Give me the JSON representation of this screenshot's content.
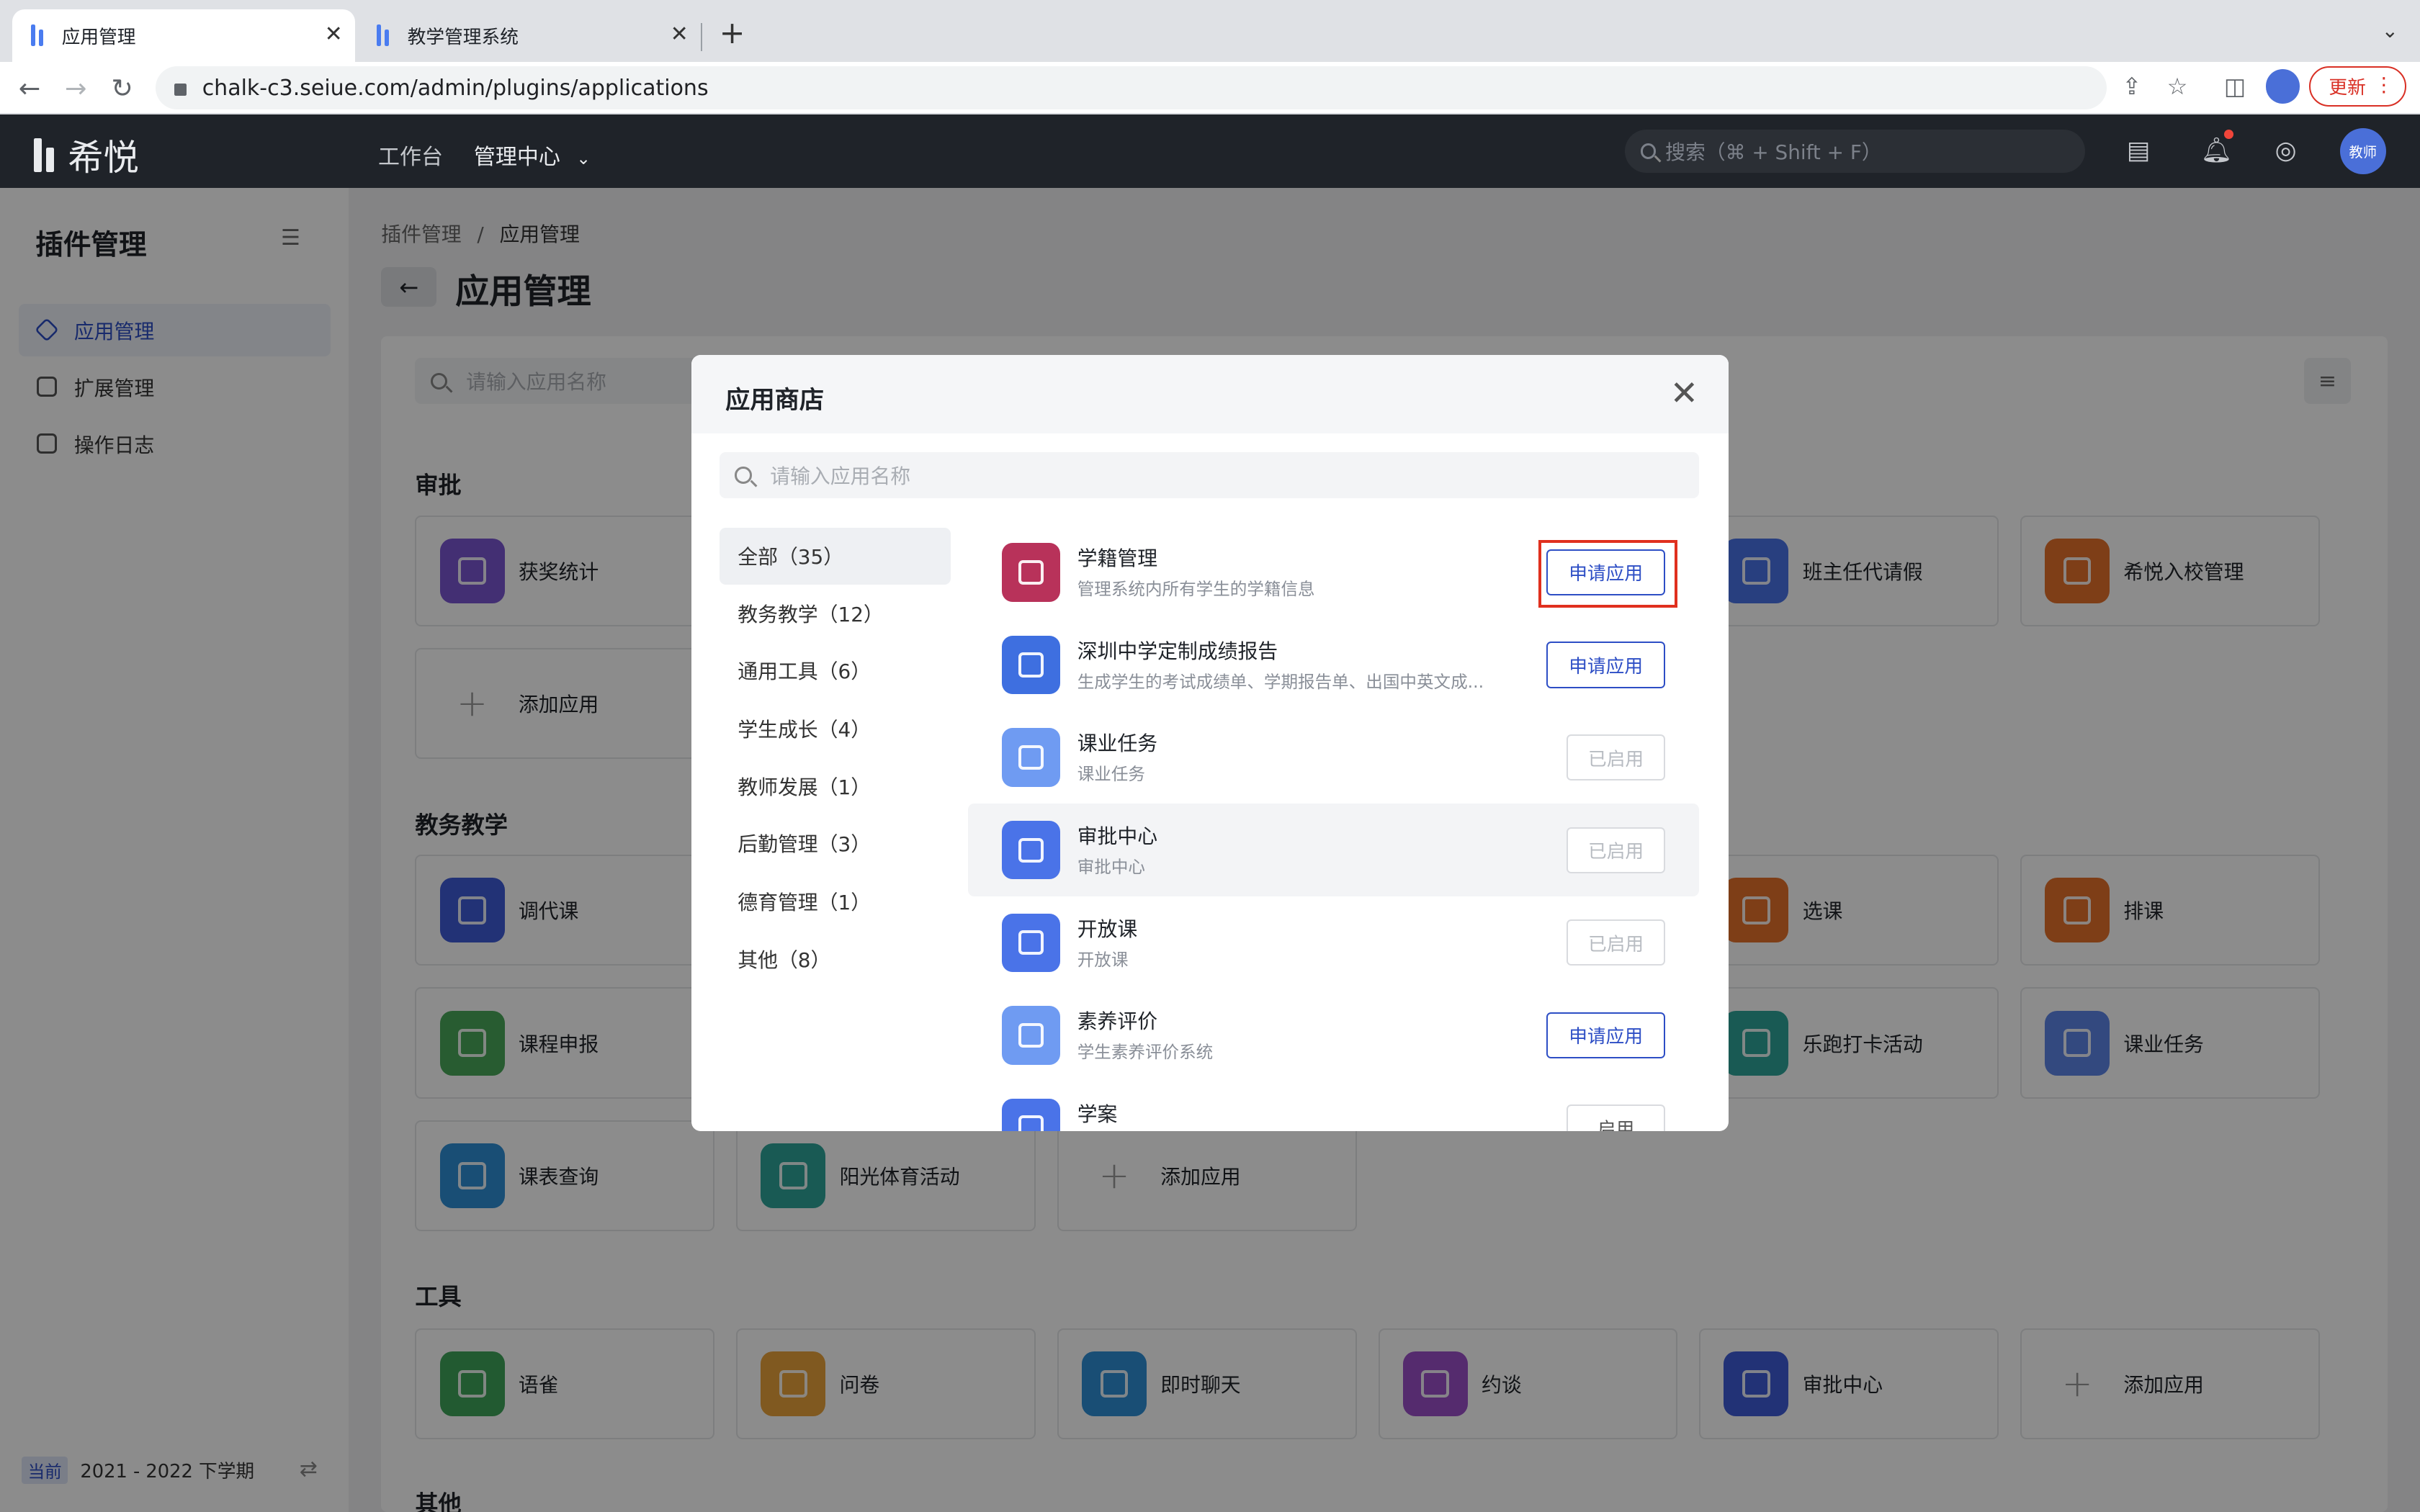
{
  "browser": {
    "tabs": [
      {
        "title": "应用管理",
        "active": true
      },
      {
        "title": "教学管理系统",
        "active": false
      }
    ],
    "url": "chalk-c3.seiue.com/admin/plugins/applications",
    "update_label": "更新"
  },
  "header": {
    "logo_text": "希悦",
    "nav": [
      "工作台",
      "管理中心"
    ],
    "search_placeholder": "搜索（⌘ + Shift + F）",
    "avatar_text": "教师"
  },
  "sidebar": {
    "title": "插件管理",
    "items": [
      {
        "label": "应用管理",
        "active": true
      },
      {
        "label": "扩展管理",
        "active": false
      },
      {
        "label": "操作日志",
        "active": false
      }
    ],
    "term_badge": "当前",
    "term": "2021 - 2022 下学期"
  },
  "main": {
    "breadcrumb": [
      "插件管理",
      "/",
      "应用管理"
    ],
    "title": "应用管理",
    "search_placeholder": "请输入应用名称",
    "sections": [
      {
        "title": "审批",
        "cards": [
          "获奖统计",
          "班主任代请假",
          "希悦入校管理",
          "添加应用"
        ]
      },
      {
        "title": "教务教学",
        "cards": [
          "调代课",
          "选课",
          "排课",
          "课程申报",
          "乐跑打卡活动",
          "课业任务",
          "课表查询",
          "阳光体育活动",
          "添加应用"
        ]
      },
      {
        "title": "工具",
        "cards": [
          "语雀",
          "问卷",
          "即时聊天",
          "约谈",
          "审批中心",
          "添加应用"
        ]
      },
      {
        "title": "其他",
        "cards": []
      }
    ]
  },
  "modal": {
    "title": "应用商店",
    "search_placeholder": "请输入应用名称",
    "categories": [
      {
        "label": "全部（35）",
        "active": true
      },
      {
        "label": "教务教学（12）",
        "active": false
      },
      {
        "label": "通用工具（6）",
        "active": false
      },
      {
        "label": "学生成长（4）",
        "active": false
      },
      {
        "label": "教师发展（1）",
        "active": false
      },
      {
        "label": "后勤管理（3）",
        "active": false
      },
      {
        "label": "德育管理（1）",
        "active": false
      },
      {
        "label": "其他（8）",
        "active": false
      }
    ],
    "apps": [
      {
        "name": "学籍管理",
        "desc": "管理系统内所有学生的学籍信息",
        "action": "申请应用",
        "color": "#b8325a"
      },
      {
        "name": "深圳中学定制成绩报告",
        "desc": "生成学生的考试成绩单、学期报告单、出国中英文成...",
        "action": "申请应用",
        "color": "#3e6fe0"
      },
      {
        "name": "课业任务",
        "desc": "课业任务",
        "action": "已启用",
        "color": "#6f9bf2"
      },
      {
        "name": "审批中心",
        "desc": "审批中心",
        "action": "已启用",
        "color": "#4a73e8"
      },
      {
        "name": "开放课",
        "desc": "开放课",
        "action": "已启用",
        "color": "#4a73e8"
      },
      {
        "name": "素养评价",
        "desc": "学生素养评价系统",
        "action": "申请应用",
        "color": "#6f9bf2"
      },
      {
        "name": "学案",
        "desc": "",
        "action": "启用",
        "color": "#4a73e8"
      }
    ]
  }
}
